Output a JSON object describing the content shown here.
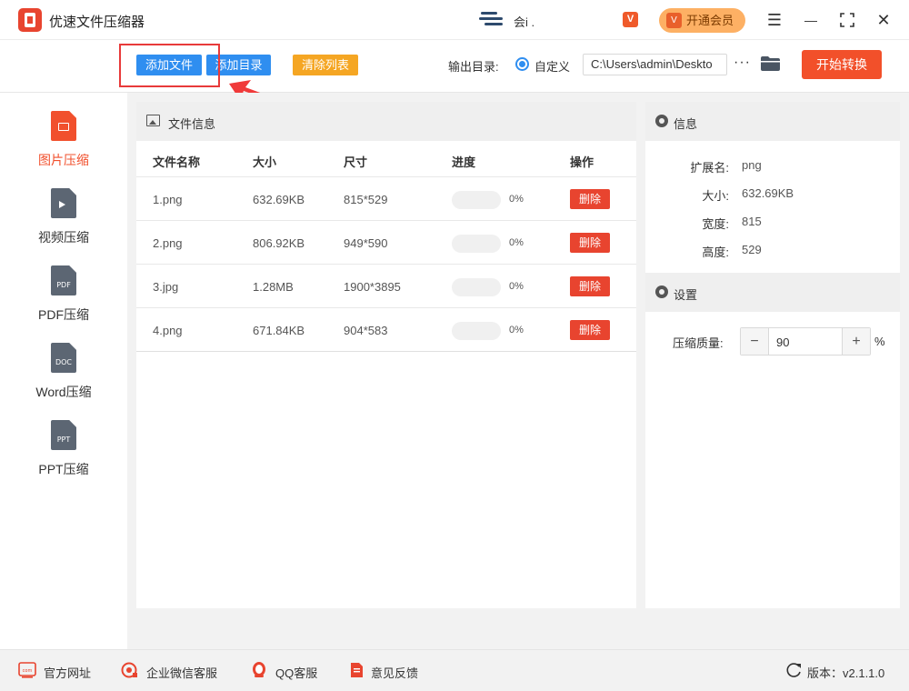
{
  "app": {
    "title": "优速文件压缩器",
    "user_name": "会i ."
  },
  "header": {
    "vip_label": "开通会员",
    "vip_badge": "V",
    "minimize": "—",
    "maximize": "⛶",
    "close": "✕",
    "menu": "☰"
  },
  "toolbar": {
    "add_file": "添加文件",
    "add_dir": "添加目录",
    "clear_list": "清除列表",
    "output_label": "输出目录:",
    "custom_label": "自定义",
    "output_path": "C:\\Users\\admin\\Deskto",
    "more": "···",
    "start": "开始转换"
  },
  "sidebar": {
    "items": [
      {
        "label": "图片压缩",
        "icon": "image-doc-icon",
        "active": true
      },
      {
        "label": "视频压缩",
        "icon": "video-doc-icon",
        "doc_text": ""
      },
      {
        "label": "PDF压缩",
        "icon": "pdf-doc-icon",
        "doc_text": "PDF"
      },
      {
        "label": "Word压缩",
        "icon": "word-doc-icon",
        "doc_text": "DOC"
      },
      {
        "label": "PPT压缩",
        "icon": "ppt-doc-icon",
        "doc_text": "PPT"
      }
    ]
  },
  "file_panel": {
    "title": "文件信息",
    "columns": [
      "文件名称",
      "大小",
      "尺寸",
      "进度",
      "操作"
    ],
    "rows": [
      {
        "name": "1.png",
        "size": "632.69KB",
        "dims": "815*529",
        "progress": 0,
        "progress_text": "0%",
        "action": "删除"
      },
      {
        "name": "2.png",
        "size": "806.92KB",
        "dims": "949*590",
        "progress": 0,
        "progress_text": "0%",
        "action": "删除"
      },
      {
        "name": "3.jpg",
        "size": "1.28MB",
        "dims": "1900*3895",
        "progress": 0,
        "progress_text": "0%",
        "action": "删除"
      },
      {
        "name": "4.png",
        "size": "671.84KB",
        "dims": "904*583",
        "progress": 0,
        "progress_text": "0%",
        "action": "删除"
      }
    ]
  },
  "info_panel": {
    "title": "信息",
    "fields": [
      {
        "key": "扩展名:",
        "value": "png"
      },
      {
        "key": "大小:",
        "value": "632.69KB"
      },
      {
        "key": "宽度:",
        "value": "815"
      },
      {
        "key": "高度:",
        "value": "529"
      }
    ]
  },
  "settings": {
    "title": "设置",
    "quality_label": "压缩质量:",
    "quality_value": "90",
    "minus": "−",
    "plus": "+",
    "unit": "%"
  },
  "footer": {
    "website": "官方网址",
    "wechat": "企业微信客服",
    "qq": "QQ客服",
    "feedback": "意见反馈",
    "version": "版本：v2.1.1.0"
  },
  "colors": {
    "accent": "#2f8ef0",
    "danger": "#e8442f",
    "start": "#f2502a",
    "vip": "#fdb064",
    "clear": "#f5a623"
  }
}
